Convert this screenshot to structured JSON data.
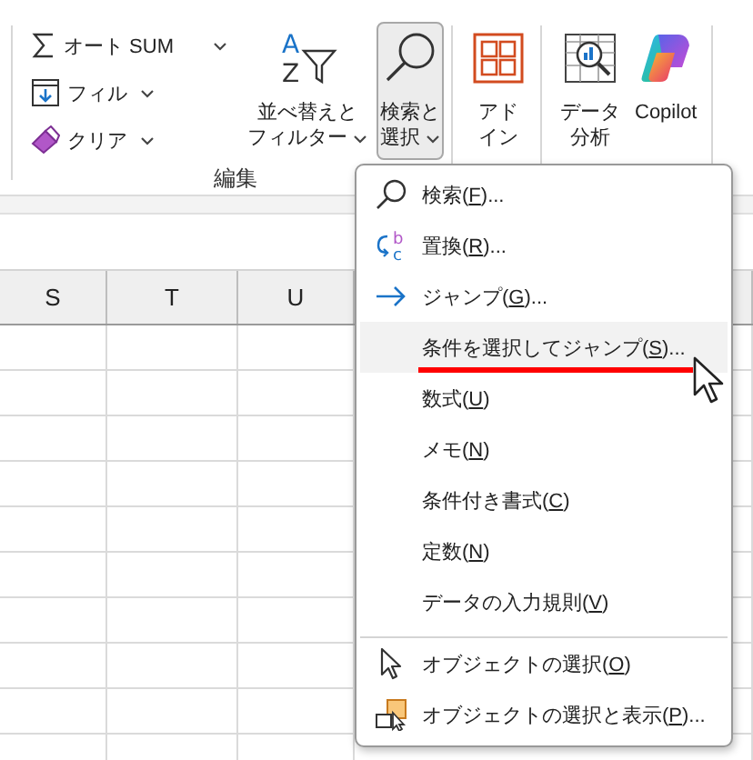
{
  "ribbon": {
    "group_label": "編集",
    "small_buttons": [
      {
        "label": "オート SUM",
        "kind": "sum",
        "dropdown": true
      },
      {
        "label": "フィル",
        "kind": "fill",
        "dropdown": true
      },
      {
        "label": "クリア",
        "kind": "clear",
        "dropdown": true
      }
    ],
    "big_buttons": [
      {
        "lines": [
          "並べ替えと",
          "フィルター"
        ],
        "kind": "sort",
        "icon_text": [
          "A",
          "Z"
        ],
        "dropdown": true,
        "selected": false
      },
      {
        "lines": [
          "検索と",
          "選択"
        ],
        "kind": "find",
        "dropdown": true,
        "selected": true
      },
      {
        "lines": [
          "アド",
          "イン"
        ],
        "kind": "addin",
        "dropdown": false,
        "selected": false
      },
      {
        "lines": [
          "データ",
          "分析"
        ],
        "kind": "analysis",
        "dropdown": false,
        "selected": false
      },
      {
        "lines": [
          "Copilot"
        ],
        "kind": "copilot",
        "dropdown": false,
        "selected": false
      }
    ]
  },
  "sheet": {
    "columns": [
      "S",
      "T",
      "U",
      ""
    ]
  },
  "menu": {
    "items": [
      {
        "before": "検索(",
        "key": "F",
        "after": ")...",
        "kind": "find",
        "selected": false,
        "separator_before": false,
        "annotated": false
      },
      {
        "before": "置換(",
        "key": "R",
        "after": ")...",
        "kind": "replace",
        "icon_text": [
          "b",
          "c"
        ],
        "selected": false,
        "separator_before": false,
        "annotated": false
      },
      {
        "before": "ジャンプ(",
        "key": "G",
        "after": ")...",
        "kind": "jump",
        "selected": false,
        "separator_before": false,
        "annotated": false
      },
      {
        "before": "条件を選択してジャンプ(",
        "key": "S",
        "after": ")...",
        "selected": true,
        "separator_before": false,
        "annotated": true
      },
      {
        "before": "数式(",
        "key": "U",
        "after": ")",
        "selected": false,
        "separator_before": false,
        "annotated": false
      },
      {
        "before": "メモ(",
        "key": "N",
        "after": ")",
        "selected": false,
        "separator_before": false,
        "annotated": false
      },
      {
        "before": "条件付き書式(",
        "key": "C",
        "after": ")",
        "selected": false,
        "separator_before": false,
        "annotated": false
      },
      {
        "before": "定数(",
        "key": "N",
        "after": ")",
        "selected": false,
        "separator_before": false,
        "annotated": false
      },
      {
        "before": "データの入力規則(",
        "key": "V",
        "after": ")",
        "selected": false,
        "separator_before": false,
        "annotated": false
      },
      {
        "before": "オブジェクトの選択(",
        "key": "O",
        "after": ")",
        "kind": "objects",
        "selected": false,
        "separator_before": true,
        "annotated": false
      },
      {
        "before": "オブジェクトの選択と表示(",
        "key": "P",
        "after": ")...",
        "kind": "pane",
        "selected": false,
        "separator_before": false,
        "annotated": false
      }
    ]
  }
}
